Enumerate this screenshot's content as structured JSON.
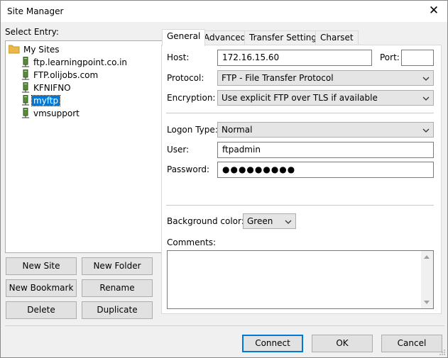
{
  "window": {
    "title": "Site Manager",
    "close_glyph": "✕"
  },
  "select_entry_label": "Select Entry:",
  "tree": {
    "root": {
      "label": "My Sites",
      "icon": "folder-icon"
    },
    "items": [
      {
        "label": "ftp.learningpoint.co.in",
        "icon": "server-icon",
        "selected": false
      },
      {
        "label": "FTP.olijobs.com",
        "icon": "server-icon",
        "selected": false
      },
      {
        "label": "KFNIFNO",
        "icon": "server-icon",
        "selected": false
      },
      {
        "label": "myftp",
        "icon": "server-icon",
        "selected": true
      },
      {
        "label": "vmsupport",
        "icon": "server-icon",
        "selected": false
      }
    ]
  },
  "left_buttons": {
    "new_site": "New Site",
    "new_folder": "New Folder",
    "new_bookmark": "New Bookmark",
    "rename": "Rename",
    "delete": "Delete",
    "duplicate": "Duplicate"
  },
  "tabs": [
    "General",
    "Advanced",
    "Transfer Settings",
    "Charset"
  ],
  "active_tab": "General",
  "general": {
    "host_label": "Host:",
    "host_value": "172.16.15.60",
    "port_label": "Port:",
    "port_value": "",
    "protocol_label": "Protocol:",
    "protocol_value": "FTP - File Transfer Protocol",
    "encryption_label": "Encryption:",
    "encryption_value": "Use explicit FTP over TLS if available",
    "logon_type_label": "Logon Type:",
    "logon_type_value": "Normal",
    "user_label": "User:",
    "user_value": "ftpadmin",
    "password_label": "Password:",
    "password_value": "●●●●●●●●●",
    "bg_color_label": "Background color:",
    "bg_color_value": "Green",
    "comments_label": "Comments:",
    "comments_value": ""
  },
  "footer_buttons": {
    "connect": "Connect",
    "ok": "OK",
    "cancel": "Cancel"
  },
  "colors": {
    "selection": "#0078d7",
    "folder": "#e8b84a",
    "window_bg": "#f0f0f0"
  }
}
